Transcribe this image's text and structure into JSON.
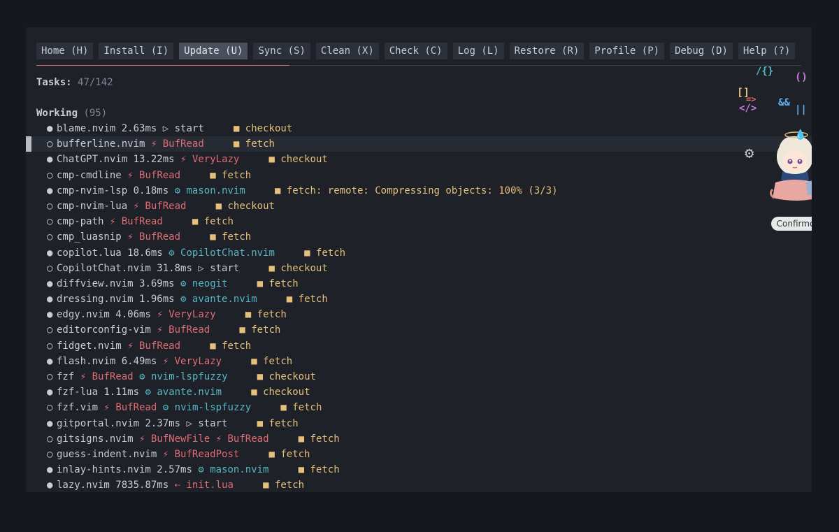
{
  "tabs": [
    {
      "label": "Home (H)"
    },
    {
      "label": "Install (I)"
    },
    {
      "label": "Update (U)",
      "active": true
    },
    {
      "label": "Sync (S)"
    },
    {
      "label": "Clean (X)"
    },
    {
      "label": "Check (C)"
    },
    {
      "label": "Log (L)"
    },
    {
      "label": "Restore (R)"
    },
    {
      "label": "Profile (P)"
    },
    {
      "label": "Debug (D)"
    },
    {
      "label": "Help (?)"
    }
  ],
  "tasks": {
    "label": "Tasks:",
    "value": "47/142"
  },
  "section": {
    "title": "Working",
    "count": "(95)"
  },
  "plugins": [
    {
      "loaded": true,
      "name": "blame.nvim",
      "time": "2.63ms",
      "trigger_icon": "play-icon",
      "trigger": "start",
      "trigger_type": "start",
      "task": "checkout"
    },
    {
      "loaded": false,
      "name": "bufferline.nvim",
      "time": "",
      "trigger_icon": "event-icon",
      "trigger": "BufRead",
      "trigger_type": "event",
      "task": "fetch",
      "cursor": true
    },
    {
      "loaded": true,
      "name": "ChatGPT.nvim",
      "time": "13.22ms",
      "trigger_icon": "event-icon",
      "trigger": "VeryLazy",
      "trigger_type": "event",
      "task": "checkout"
    },
    {
      "loaded": false,
      "name": "cmp-cmdline",
      "time": "",
      "trigger_icon": "event-icon",
      "trigger": "BufRead",
      "trigger_type": "event",
      "task": "fetch"
    },
    {
      "loaded": true,
      "name": "cmp-nvim-lsp",
      "time": "0.18ms",
      "trigger_icon": "plugin-icon",
      "trigger": "mason.nvim",
      "trigger_type": "plugin",
      "task": "fetch: remote: Compressing objects: 100% (3/3)"
    },
    {
      "loaded": false,
      "name": "cmp-nvim-lua",
      "time": "",
      "trigger_icon": "event-icon",
      "trigger": "BufRead",
      "trigger_type": "event",
      "task": "checkout"
    },
    {
      "loaded": false,
      "name": "cmp-path",
      "time": "",
      "trigger_icon": "event-icon",
      "trigger": "BufRead",
      "trigger_type": "event",
      "task": "fetch"
    },
    {
      "loaded": false,
      "name": "cmp_luasnip",
      "time": "",
      "trigger_icon": "event-icon",
      "trigger": "BufRead",
      "trigger_type": "event",
      "task": "fetch"
    },
    {
      "loaded": true,
      "name": "copilot.lua",
      "time": "18.6ms",
      "trigger_icon": "plugin-icon",
      "trigger": "CopilotChat.nvim",
      "trigger_type": "plugin",
      "task": "fetch"
    },
    {
      "loaded": false,
      "name": "CopilotChat.nvim",
      "time": "31.8ms",
      "trigger_icon": "play-icon",
      "trigger": "start",
      "trigger_type": "start",
      "task": "checkout"
    },
    {
      "loaded": true,
      "name": "diffview.nvim",
      "time": "3.69ms",
      "trigger_icon": "plugin-icon",
      "trigger": "neogit",
      "trigger_type": "plugin",
      "task": "fetch"
    },
    {
      "loaded": true,
      "name": "dressing.nvim",
      "time": "1.96ms",
      "trigger_icon": "plugin-icon",
      "trigger": "avante.nvim",
      "trigger_type": "plugin",
      "task": "fetch"
    },
    {
      "loaded": true,
      "name": "edgy.nvim",
      "time": "4.06ms",
      "trigger_icon": "event-icon",
      "trigger": "VeryLazy",
      "trigger_type": "event",
      "task": "fetch"
    },
    {
      "loaded": false,
      "name": "editorconfig-vim",
      "time": "",
      "trigger_icon": "event-icon",
      "trigger": "BufRead",
      "trigger_type": "event",
      "task": "fetch"
    },
    {
      "loaded": false,
      "name": "fidget.nvim",
      "time": "",
      "trigger_icon": "event-icon",
      "trigger": "BufRead",
      "trigger_type": "event",
      "task": "fetch"
    },
    {
      "loaded": true,
      "name": "flash.nvim",
      "time": "6.49ms",
      "trigger_icon": "event-icon",
      "trigger": "VeryLazy",
      "trigger_type": "event",
      "task": "fetch"
    },
    {
      "loaded": false,
      "name": "fzf",
      "time": "",
      "trigger_icon": "event-icon",
      "trigger": "BufRead",
      "trigger_type": "event",
      "trigger2_icon": "plugin-icon",
      "trigger2": "nvim-lspfuzzy",
      "trigger2_type": "plugin",
      "task": "checkout"
    },
    {
      "loaded": true,
      "name": "fzf-lua",
      "time": "1.11ms",
      "trigger_icon": "plugin-icon",
      "trigger": "avante.nvim",
      "trigger_type": "plugin",
      "task": "checkout"
    },
    {
      "loaded": false,
      "name": "fzf.vim",
      "time": "",
      "trigger_icon": "event-icon",
      "trigger": "BufRead",
      "trigger_type": "event",
      "trigger2_icon": "plugin-icon",
      "trigger2": "nvim-lspfuzzy",
      "trigger2_type": "plugin",
      "task": "fetch"
    },
    {
      "loaded": true,
      "name": "gitportal.nvim",
      "time": "2.37ms",
      "trigger_icon": "play-icon",
      "trigger": "start",
      "trigger_type": "start",
      "task": "fetch"
    },
    {
      "loaded": false,
      "name": "gitsigns.nvim",
      "time": "",
      "trigger_icon": "event-icon",
      "trigger": "BufNewFile",
      "trigger_type": "event",
      "trigger2_icon": "event-icon",
      "trigger2": "BufRead",
      "trigger2_type": "event",
      "task": "fetch"
    },
    {
      "loaded": false,
      "name": "guess-indent.nvim",
      "time": "",
      "trigger_icon": "event-icon",
      "trigger": "BufReadPost",
      "trigger_type": "event",
      "task": "fetch"
    },
    {
      "loaded": true,
      "name": "inlay-hints.nvim",
      "time": "2.57ms",
      "trigger_icon": "plugin-icon",
      "trigger": "mason.nvim",
      "trigger_type": "plugin",
      "task": "fetch"
    },
    {
      "loaded": true,
      "name": "lazy.nvim",
      "time": "7835.87ms",
      "trigger_icon": "init-icon",
      "trigger": "init.lua",
      "trigger_type": "event",
      "task": "fetch"
    }
  ],
  "widget": {
    "button_label": "Confirmo",
    "icon": "settings-gear-icon",
    "avatar": "anime-character-avatar"
  }
}
